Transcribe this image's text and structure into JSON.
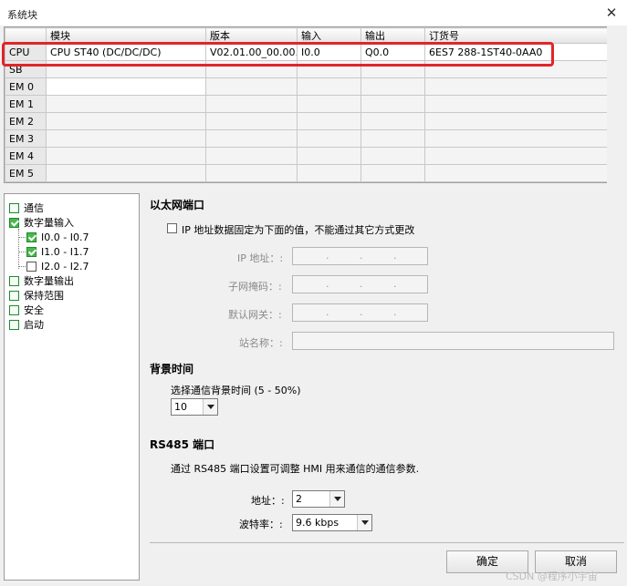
{
  "window": {
    "title": "系统块",
    "close_glyph": "✕"
  },
  "grid": {
    "columns": [
      "",
      "模块",
      "版本",
      "输入",
      "输出",
      "订货号"
    ],
    "rows": [
      {
        "slot": "CPU",
        "module": "CPU ST40 (DC/DC/DC)",
        "version": "V02.01.00_00.00...",
        "input": "I0.0",
        "output": "Q0.0",
        "order": "6ES7 288-1ST40-0AA0"
      },
      {
        "slot": "SB",
        "module": "",
        "version": "",
        "input": "",
        "output": "",
        "order": ""
      },
      {
        "slot": "EM 0",
        "module": "",
        "version": "",
        "input": "",
        "output": "",
        "order": ""
      },
      {
        "slot": "EM 1",
        "module": "",
        "version": "",
        "input": "",
        "output": "",
        "order": ""
      },
      {
        "slot": "EM 2",
        "module": "",
        "version": "",
        "input": "",
        "output": "",
        "order": ""
      },
      {
        "slot": "EM 3",
        "module": "",
        "version": "",
        "input": "",
        "output": "",
        "order": ""
      },
      {
        "slot": "EM 4",
        "module": "",
        "version": "",
        "input": "",
        "output": "",
        "order": ""
      },
      {
        "slot": "EM 5",
        "module": "",
        "version": "",
        "input": "",
        "output": "",
        "order": ""
      }
    ]
  },
  "tree": {
    "comm": "通信",
    "digital_input": "数字量输入",
    "di_0": "I0.0 - I0.7",
    "di_1": "I1.0 - I1.7",
    "di_2": "I2.0 - I2.7",
    "digital_output": "数字量输出",
    "retentive": "保持范围",
    "security": "安全",
    "startup": "启动"
  },
  "ethernet": {
    "heading": "以太网端口",
    "fixed_ip_label": "IP 地址数据固定为下面的值，不能通过其它方式更改",
    "ip_label": "IP 地址：:",
    "subnet_label": "子网掩码：:",
    "gateway_label": "默认网关：:",
    "station_label": "站名称：:",
    "dot": "."
  },
  "background": {
    "heading": "背景时间",
    "label": "选择通信背景时间 (5 - 50%)",
    "value": "10"
  },
  "rs485": {
    "heading": "RS485 端口",
    "desc": "通过 RS485 端口设置可调整 HMI 用来通信的通信参数.",
    "address_label": "地址：:",
    "address_value": "2",
    "baud_label": "波特率：:",
    "baud_value": "9.6 kbps"
  },
  "buttons": {
    "ok": "确定",
    "cancel": "取消"
  },
  "watermark": "CSDN @程序小宇宙"
}
